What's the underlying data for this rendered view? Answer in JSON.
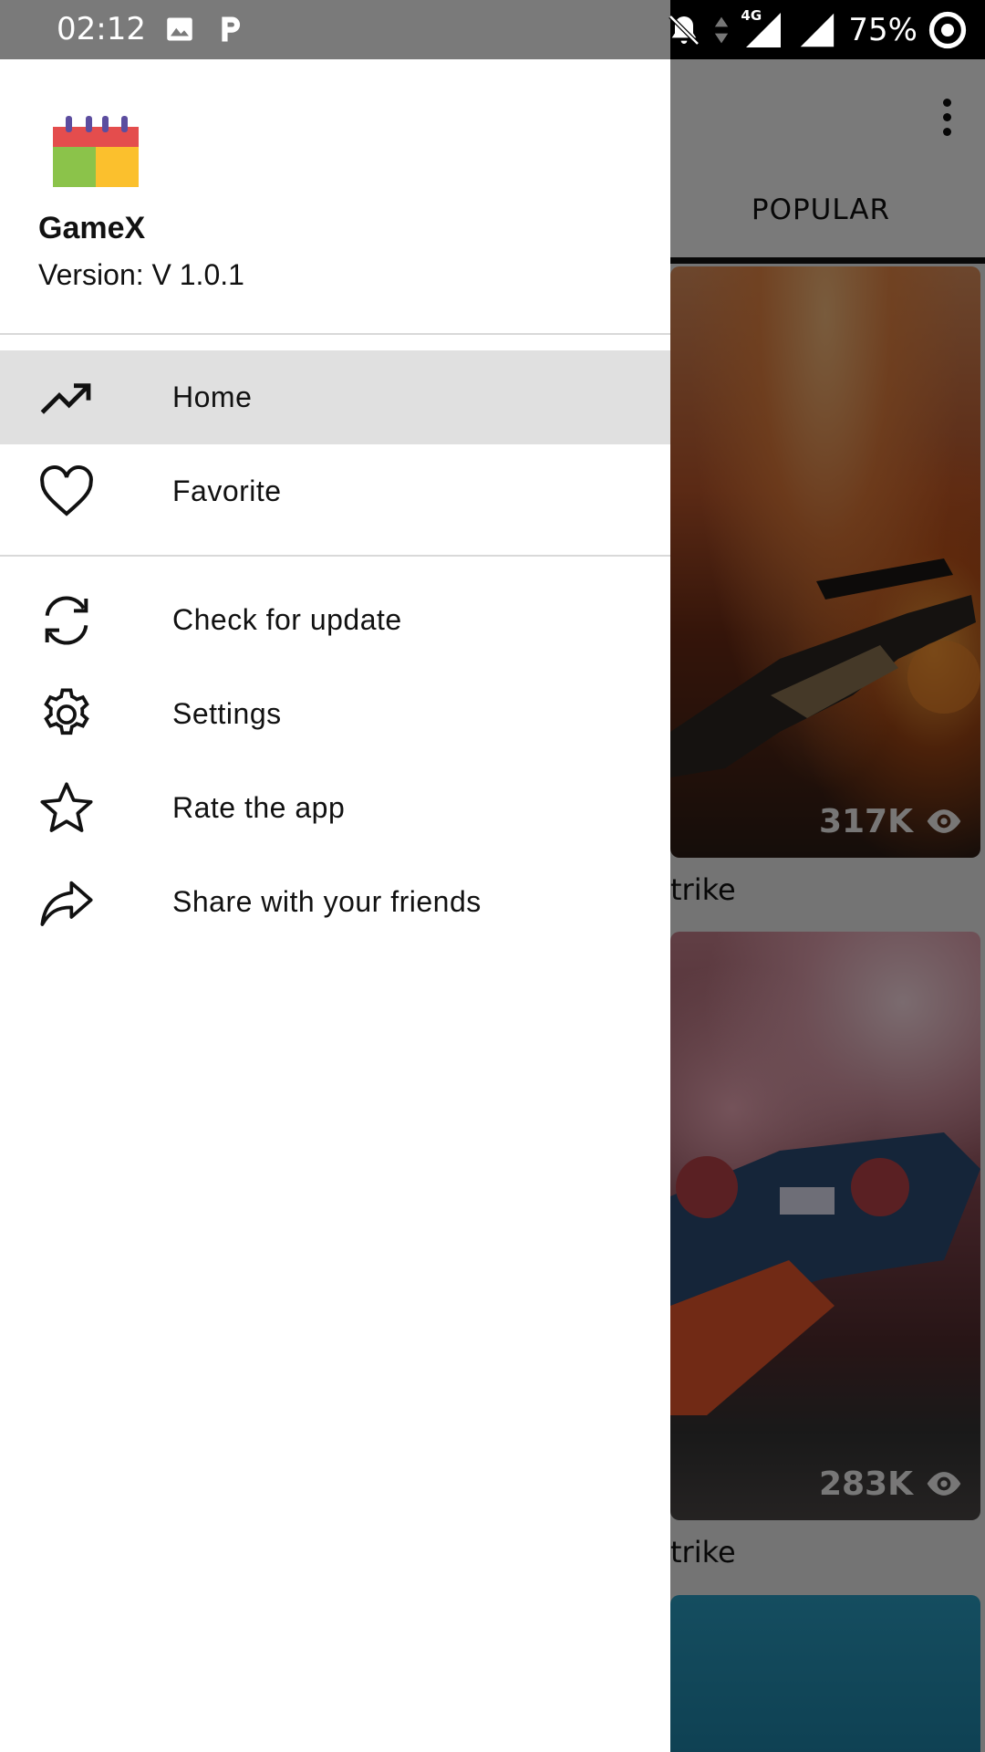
{
  "status_bar": {
    "time": "02:12",
    "network_label": "4G",
    "battery": "75%",
    "icons": [
      "image-icon",
      "p-icon",
      "mute-icon",
      "data-arrows-icon",
      "signal-icon",
      "signal-icon-2",
      "eye-icon"
    ]
  },
  "drawer": {
    "app_name": "GameX",
    "version": "Version: V 1.0.1",
    "items_primary": [
      {
        "label": "Home",
        "icon": "trending-up-icon",
        "active": true
      },
      {
        "label": "Favorite",
        "icon": "heart-icon",
        "active": false
      }
    ],
    "items_secondary": [
      {
        "label": "Check for update",
        "icon": "refresh-icon"
      },
      {
        "label": "Settings",
        "icon": "gear-icon"
      },
      {
        "label": "Rate the app",
        "icon": "star-icon"
      },
      {
        "label": "Share with your friends",
        "icon": "share-icon"
      }
    ]
  },
  "background": {
    "tab_label": "POPULAR",
    "cards": [
      {
        "views": "317K",
        "title_fragment": "trike"
      },
      {
        "views": "283K",
        "title_fragment": "trike"
      }
    ]
  },
  "colors": {
    "drawer_bg": "#ffffff",
    "active_item_bg": "#e0e0e0",
    "logo_red": "#e44d4d",
    "logo_green": "#8bc34a",
    "logo_yellow": "#fbc02d",
    "logo_purple": "#5c4d9f"
  }
}
